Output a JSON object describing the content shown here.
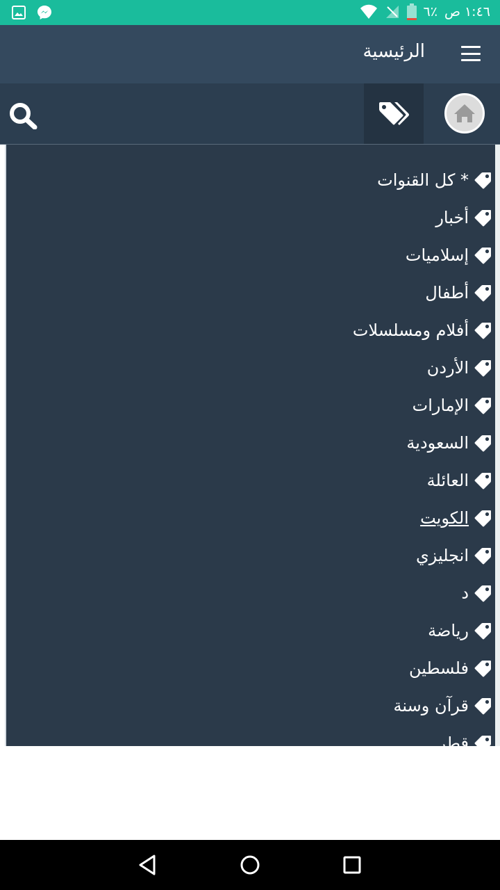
{
  "status_bar": {
    "time": "١:٤٦ ص",
    "battery": "٦٪",
    "icons": [
      "gallery-icon",
      "messenger-icon",
      "wifi-icon",
      "signal-icon",
      "battery-icon"
    ]
  },
  "app_bar": {
    "title": "الرئيسية",
    "menu_icon": "hamburger-icon"
  },
  "toolbar": {
    "home_icon": "home-icon",
    "tags_icon": "tags-icon",
    "search_icon": "search-icon"
  },
  "categories": [
    "* كل القنوات",
    "أخبار",
    "إسلاميات",
    "أطفال",
    "أفلام ومسلسلات",
    "الأردن",
    "الإمارات",
    "السعودية",
    "العائلة",
    "الكويت",
    "انجليزي",
    "د",
    "رياضة",
    " فلسطين",
    "قرآن وسنة",
    "قطر"
  ],
  "colors": {
    "status_bar": "#1abc9c",
    "app_bar": "#34495e",
    "toolbar": "#2c3e50",
    "list_background": "#2b3a4a",
    "text": "#ffffff"
  }
}
